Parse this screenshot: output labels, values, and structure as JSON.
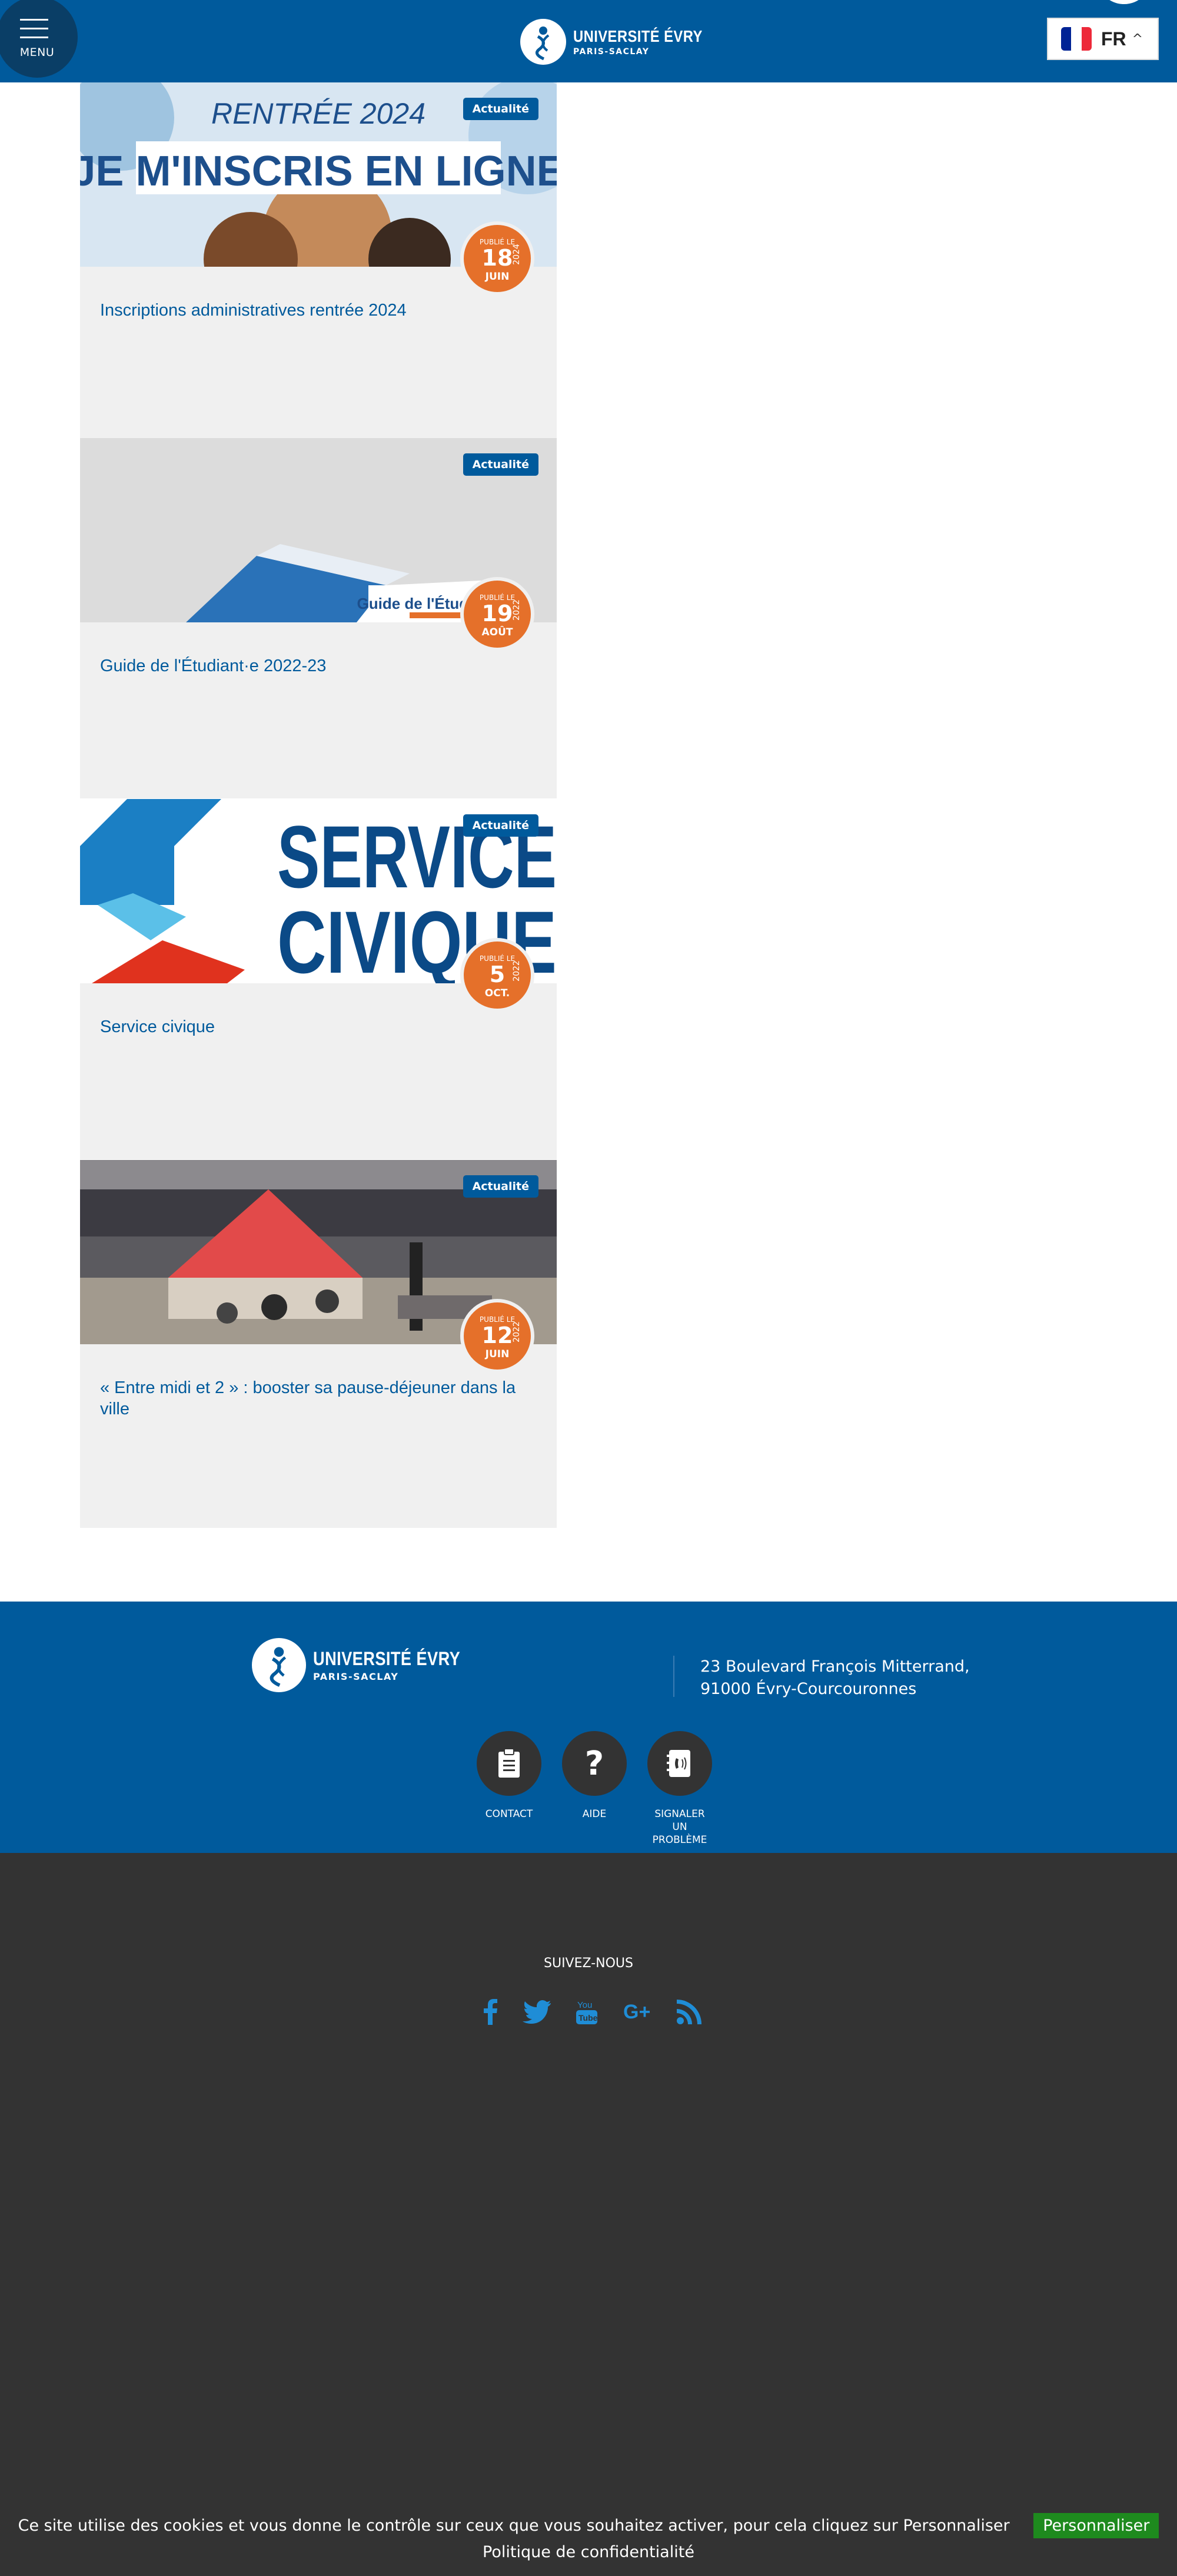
{
  "header": {
    "menu_label": "MENU",
    "logo_line1": "UNIVERSITÉ ÉVRY",
    "logo_line2": "PARIS-SACLAY",
    "language": "FR"
  },
  "cards": [
    {
      "badge": "Actualité",
      "published": "PUBLIÉ LE",
      "day": "18",
      "month": "JUIN",
      "year": "2024",
      "title": "Inscriptions administratives rentrée 2024",
      "image_text_1": "RENTRÉE 2024",
      "image_text_2": "JE M'INSCRIS EN LIGNE"
    },
    {
      "badge": "Actualité",
      "published": "PUBLIÉ LE",
      "day": "19",
      "month": "AOÛT",
      "year": "2022",
      "title": "Guide de l'Étudiant·e 2022-23",
      "image_text_1": "Guide de l'Étudiant·e"
    },
    {
      "badge": "Actualité",
      "published": "PUBLIÉ LE",
      "day": "5",
      "month": "OCT.",
      "year": "2022",
      "title": "Service civique",
      "image_text_1": "SERVICE",
      "image_text_2": "CIVIQUE"
    },
    {
      "badge": "Actualité",
      "published": "PUBLIÉ LE",
      "day": "12",
      "month": "JUIN",
      "year": "2022",
      "title": "« Entre midi et 2 » : booster sa pause-déjeuner dans la ville"
    }
  ],
  "footer": {
    "logo_line1": "UNIVERSITÉ ÉVRY",
    "logo_line2": "PARIS-SACLAY",
    "address_line1": "23 Boulevard François Mitterrand,",
    "address_line2": "91000 Évry-Courcouronnes",
    "buttons": [
      {
        "label": "CONTACT",
        "icon": "clipboard-icon"
      },
      {
        "label": "AIDE",
        "icon": "question-icon"
      },
      {
        "label": "SIGNALER UN PROBLÈME",
        "icon": "phone-book-icon"
      }
    ],
    "follow_label": "SUIVEZ-NOUS",
    "social": [
      "facebook-icon",
      "twitter-icon",
      "youtube-icon",
      "google-plus-icon",
      "rss-icon"
    ]
  },
  "cookie_banner": {
    "text": "Ce site utilise des cookies et vous donne le contrôle sur ceux que vous souhaitez activer, pour cela cliquez sur Personnaliser",
    "button": "Personnaliser",
    "privacy_link": "Politique de confidentialité"
  },
  "colors": {
    "brand_blue": "#005a9c",
    "date_orange": "#e5702a",
    "footer_dark": "#333333",
    "cookie_green": "#1e8a1e"
  }
}
